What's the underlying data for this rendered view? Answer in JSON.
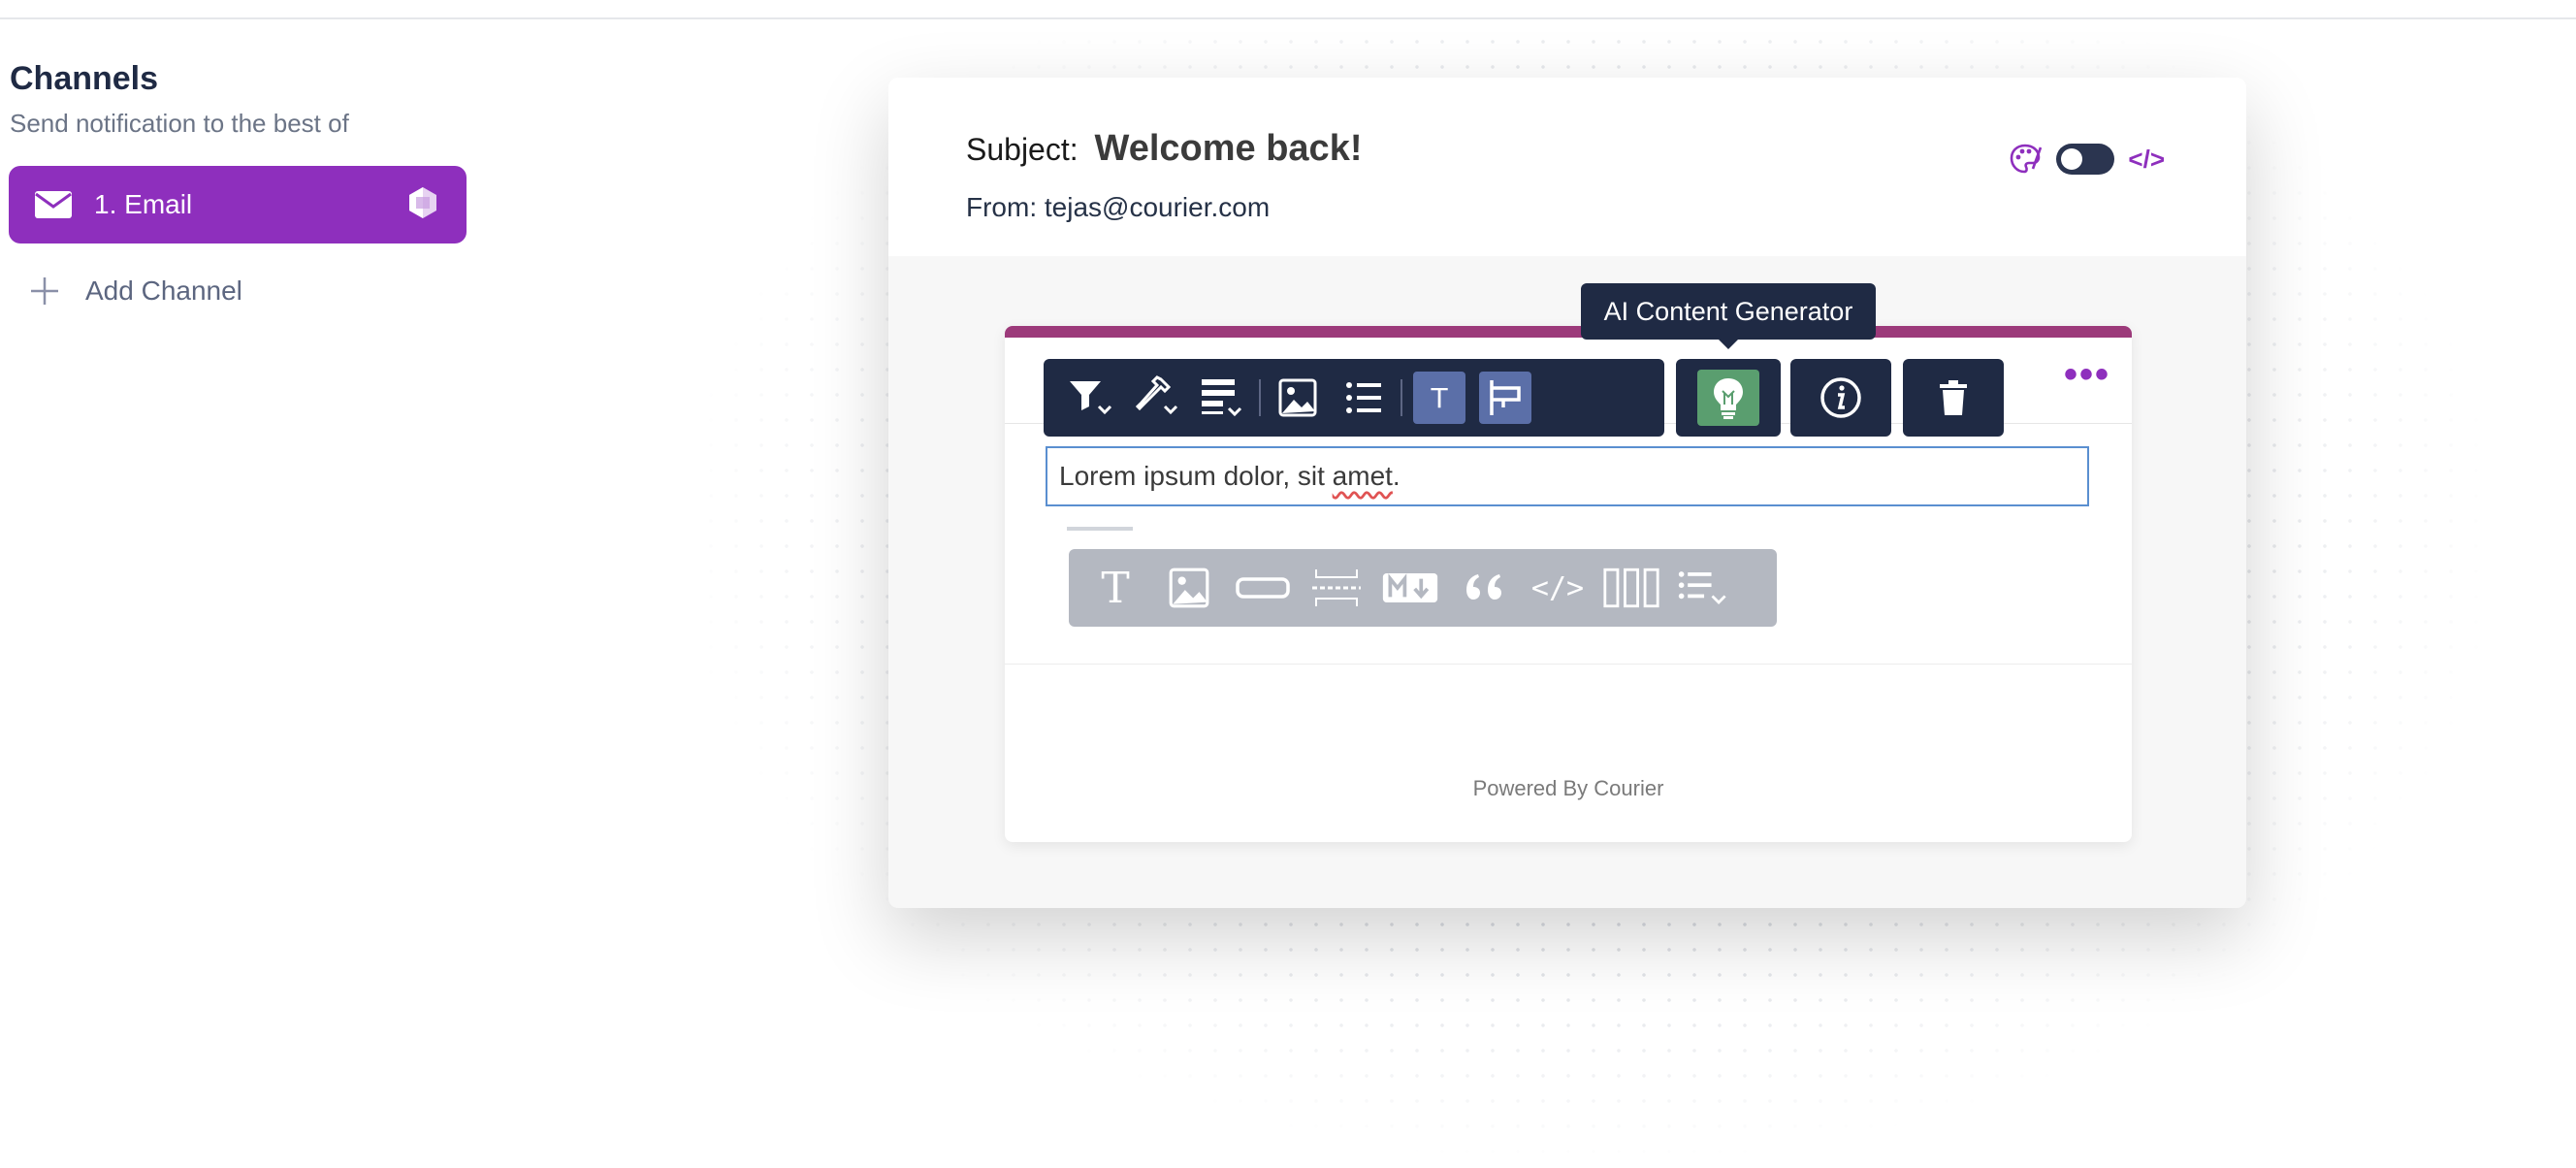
{
  "sidebar": {
    "title": "Channels",
    "subtitle": "Send notification to the best of",
    "channels": [
      {
        "number": "1.",
        "label": "Email",
        "icon": "envelope-icon",
        "provider_icon": "courier-logo-icon"
      }
    ],
    "add_channel_label": "Add Channel"
  },
  "email": {
    "subject_label": "Subject:",
    "subject_value": "Welcome back!",
    "from_label": "From:",
    "from_value": "tejas@courier.com",
    "header_icons": [
      "palette-icon",
      "toggle-switch",
      "code-icon"
    ],
    "code_glyph": "</>"
  },
  "block_toolbar": {
    "icons": [
      "filter-icon",
      "eyedropper-icon",
      "align-icon",
      "image-icon",
      "list-icon",
      "text-style-icon",
      "flag-icon"
    ],
    "text_style_glyph": "T",
    "ai_icon": "lightbulb-icon",
    "info_icon": "info-icon",
    "delete_icon": "trash-icon",
    "more_glyph": "•••"
  },
  "tooltip": {
    "text": "AI Content Generator"
  },
  "content": {
    "text_plain": "Lorem ipsum dolor, sit ",
    "text_misspelled": "amet",
    "text_end": "."
  },
  "insert_toolbar": {
    "icons": [
      "text-block-icon",
      "image-block-icon",
      "button-block-icon",
      "divider-block-icon",
      "markdown-block-icon",
      "quote-block-icon",
      "code-block-icon",
      "columns-block-icon",
      "list-block-icon"
    ],
    "text_glyph": "T",
    "quote_glyph": "66",
    "code_glyph": "</>"
  },
  "footer": {
    "powered_by": "Powered By Courier"
  },
  "colors": {
    "accent": "#8e2fbd",
    "toolbar": "#1f2a44",
    "ai_green": "#5a9e6f",
    "selected": "#5b6fa8"
  }
}
